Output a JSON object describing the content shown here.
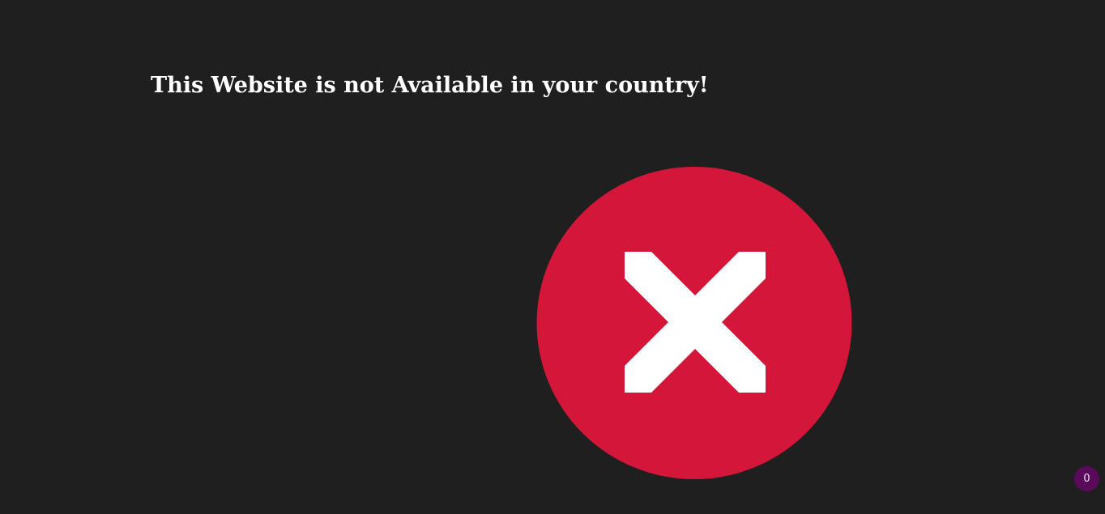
{
  "message": {
    "headline": "This Website is not Available in your country!"
  },
  "error_icon": {
    "name": "blocked-x-icon",
    "circle_color": "#d4163a",
    "cross_color": "#ffffff"
  },
  "badge": {
    "count": "0",
    "color": "#5b0a5b"
  },
  "colors": {
    "background": "#1f1f1f",
    "text": "#ffffff"
  }
}
